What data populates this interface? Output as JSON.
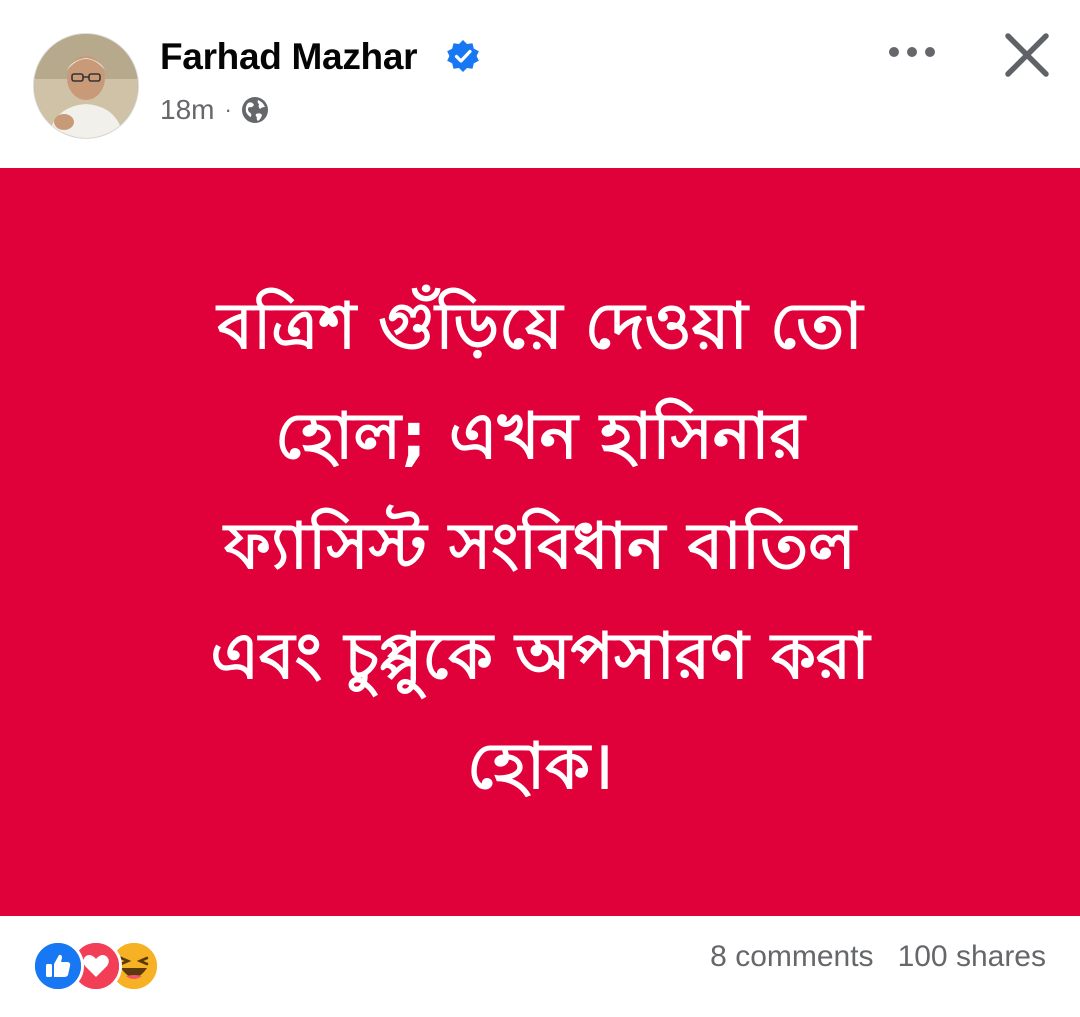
{
  "post": {
    "author": "Farhad Mazhar",
    "timestamp": "18m",
    "separator": "·",
    "audience_icon": "globe-icon",
    "verified_icon": "verified-badge-icon",
    "verified_color": "#1877f2",
    "menu_icon": "more-options-icon",
    "close_icon": "close-icon"
  },
  "card": {
    "background": "#e0003a",
    "lines": [
      "বত্রিশ গুঁড়িয়ে দেওয়া তো",
      "হোল; এখন হাসিনার",
      "ফ্যাসিস্ট সংবিধান বাতিল",
      "এবং চুপ্পুকে অপসারণ করা",
      "হোক।"
    ]
  },
  "footer": {
    "reactions": [
      "like-reaction-icon",
      "love-reaction-icon",
      "haha-reaction-icon"
    ],
    "comments": "8 comments",
    "shares": "100 shares"
  }
}
